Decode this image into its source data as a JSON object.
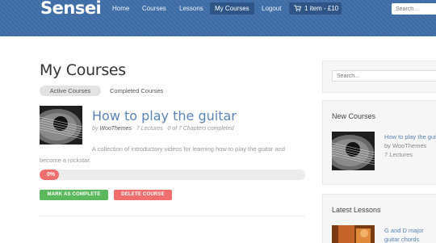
{
  "header": {
    "logo": "Sensei",
    "nav": [
      "Home",
      "Courses",
      "Lessons",
      "My Courses",
      "Logout"
    ],
    "active_nav": "My Courses",
    "cart_label": "1 item - £10",
    "search_placeholder": "Search...",
    "colors": {
      "bar": "#3f6ea8",
      "active": "#2e5586"
    }
  },
  "main": {
    "title": "My Courses",
    "tabs": {
      "active": "Active Courses",
      "completed": "Completed Courses"
    },
    "course": {
      "title": "How to play the guitar",
      "by": "by",
      "author": "WooThemes",
      "lectures": "7 Lectures",
      "chapters": "0 of 7 Chapters completed",
      "description": "A collection of introductory videos for learning how to play the guitar and become a rockstar.",
      "progress_label": "0%",
      "progress_value": 0,
      "mark_complete_label": "MARK AS COMPLETE",
      "delete_label": "DELETE COURSE",
      "thumbnail_icon": "guitar-image"
    }
  },
  "sidebar": {
    "search_placeholder": "Search...",
    "new_courses": {
      "heading": "New Courses",
      "course_title": "How to play the guitar",
      "byline": "by WooThemes",
      "lectures": "7 Lectures"
    },
    "latest_lessons": {
      "heading": "Latest Lessons",
      "lesson_title": "G and D major guitar chords"
    }
  }
}
